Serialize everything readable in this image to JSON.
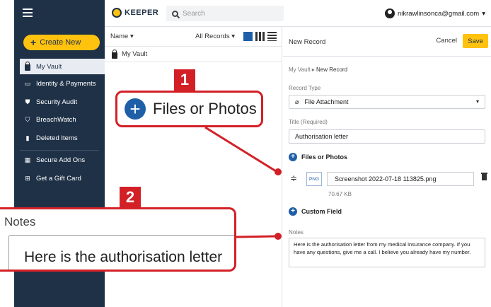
{
  "sidebar": {
    "create_label": "Create New",
    "items": [
      {
        "label": "My Vault",
        "icon": "lock-icon"
      },
      {
        "label": "Identity & Payments",
        "icon": "card-icon"
      },
      {
        "label": "Security Audit",
        "icon": "shield-icon"
      },
      {
        "label": "BreachWatch",
        "icon": "shield-alert-icon"
      },
      {
        "label": "Deleted Items",
        "icon": "trash-icon"
      },
      {
        "label": "Secure Add Ons",
        "icon": "grid-icon"
      },
      {
        "label": "Get a Gift Card",
        "icon": "gift-icon"
      }
    ]
  },
  "header": {
    "logo": "KEEPER",
    "search_placeholder": "Search",
    "user_email": "nikrawlinsonca@gmail.com"
  },
  "list": {
    "sort_label": "Name",
    "filter_label": "All Records",
    "vault_item": "My Vault"
  },
  "record": {
    "header_title": "New Record",
    "cancel_label": "Cancel",
    "save_label": "Save",
    "breadcrumb_root": "My Vault",
    "breadcrumb_current": "New Record",
    "record_type_label": "Record Type",
    "record_type_value": "File Attachment",
    "title_label": "Title (Required)",
    "title_value": "Authorisation letter",
    "files_section": "Files or Photos",
    "file_type": "PNG",
    "file_name": "Screenshot 2022-07-18 113825.png",
    "file_size": "70.67 KB",
    "custom_field_label": "Custom Field",
    "notes_label": "Notes",
    "notes_value": "Here is the authorisation letter from my medical insurance company. If you have any questions, give me a call. I believe you already have my number."
  },
  "callouts": {
    "badge1": "1",
    "badge2": "2",
    "zoom1_text": "Files or Photos",
    "zoom2_label": "Notes",
    "zoom2_text": "Here is the authorisation letter"
  },
  "colors": {
    "sidebar": "#1f3147",
    "accent": "#ffc20e",
    "callout": "#d32027",
    "blue": "#1f5fa8"
  }
}
